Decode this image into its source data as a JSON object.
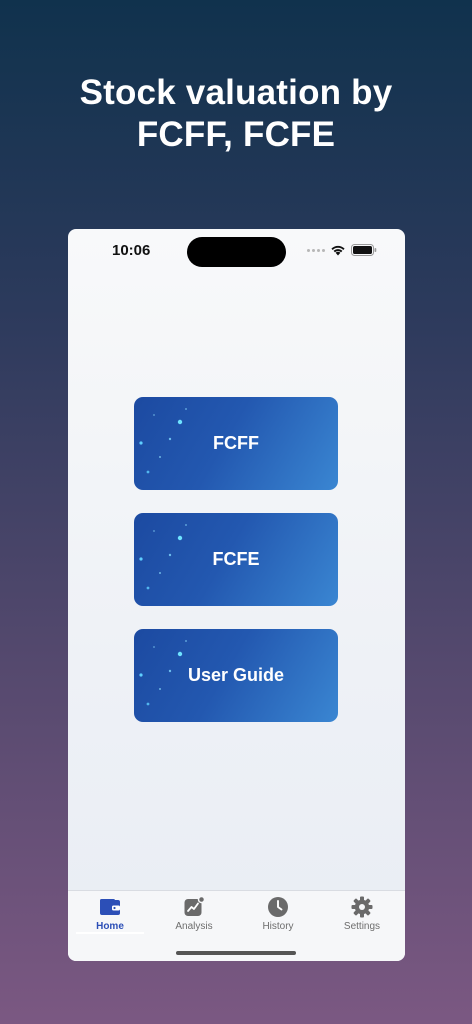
{
  "headline": {
    "line1": "Stock valuation by",
    "line2": "FCFF, FCFE"
  },
  "status_bar": {
    "time": "10:06"
  },
  "menu": {
    "buttons": [
      {
        "label": "FCFF"
      },
      {
        "label": "FCFE"
      },
      {
        "label": "User Guide"
      }
    ]
  },
  "tabbar": {
    "active": "Home",
    "tabs": [
      {
        "label": "Home",
        "icon": "wallet-icon"
      },
      {
        "label": "Analysis",
        "icon": "chart-icon"
      },
      {
        "label": "History",
        "icon": "clock-icon"
      },
      {
        "label": "Settings",
        "icon": "gear-icon"
      }
    ]
  },
  "colors": {
    "accent": "#2c4fb7",
    "button_start": "#1c4aa1",
    "button_end": "#3a86d2"
  }
}
